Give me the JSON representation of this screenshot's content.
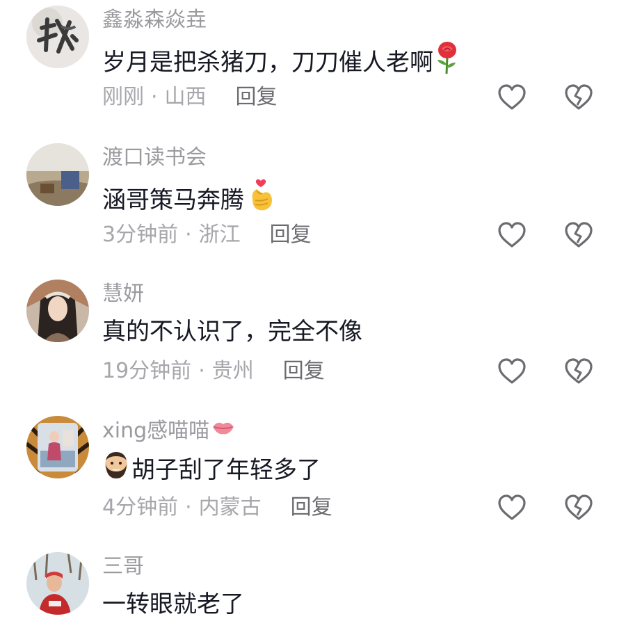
{
  "comments": [
    {
      "username": "鑫淼森焱垚",
      "text": "岁月是把杀猪刀，刀刀催人老啊",
      "emoji": "rose-icon",
      "time": "刚刚",
      "separator": "·",
      "location": "山西",
      "reply_label": "回复"
    },
    {
      "username": "渡口读书会",
      "text": "涵哥策马奔腾",
      "emoji": "finger-heart-icon",
      "time": "3分钟前",
      "separator": "·",
      "location": "浙江",
      "reply_label": "回复"
    },
    {
      "username": "慧妍",
      "text": "真的不认识了，完全不像",
      "time": "19分钟前",
      "separator": "·",
      "location": "贵州",
      "reply_label": "回复"
    },
    {
      "username": "xing感喵喵",
      "username_emoji": "kiss-lips-icon",
      "emoji_prefix": "bearded-man-icon",
      "text": "胡子刮了年轻多了",
      "time": "4分钟前",
      "separator": "·",
      "location": "内蒙古",
      "reply_label": "回复"
    },
    {
      "username": "三哥",
      "text": "一转眼就老了"
    }
  ],
  "icons": {
    "like": "heart-outline-icon",
    "dislike": "broken-heart-outline-icon"
  },
  "colors": {
    "username": "#9a9a9f",
    "text": "#161823",
    "meta": "#a6a6ab",
    "icon_stroke": "#6b6b70"
  }
}
